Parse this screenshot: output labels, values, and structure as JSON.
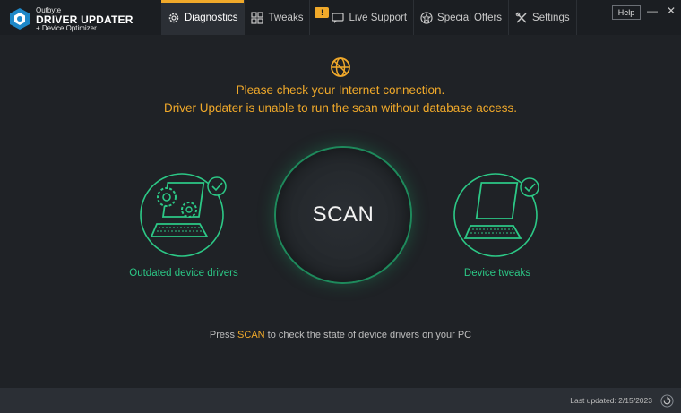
{
  "app": {
    "brand_small": "Outbyte",
    "brand_big": "DRIVER UPDATER",
    "brand_sub": "+ Device Optimizer"
  },
  "tabs": [
    {
      "label": "Diagnostics",
      "icon": "gear-icon",
      "active": true
    },
    {
      "label": "Tweaks",
      "icon": "grid-icon",
      "active": false
    },
    {
      "label": "Live Support",
      "icon": "chat-icon",
      "active": false,
      "badge": "!"
    },
    {
      "label": "Special Offers",
      "icon": "star-icon",
      "active": false
    },
    {
      "label": "Settings",
      "icon": "tools-icon",
      "active": false
    }
  ],
  "window": {
    "help_label": "Help",
    "minimize_glyph": "—",
    "close_glyph": "✕"
  },
  "message": {
    "line1": "Please check your Internet connection.",
    "line2": "Driver Updater is unable to run the scan without database access."
  },
  "left_feature": {
    "label": "Outdated device drivers",
    "icon": "laptop-gears-icon"
  },
  "right_feature": {
    "label": "Device tweaks",
    "icon": "laptop-icon"
  },
  "scan": {
    "label": "SCAN"
  },
  "hint": {
    "prefix": "Press ",
    "keyword": "SCAN",
    "suffix": " to check the state of device drivers on your PC"
  },
  "status": {
    "last_updated": "Last updated: 2/15/2023"
  },
  "colors": {
    "accent": "#f0a92a",
    "green": "#2cc886",
    "background": "#1f2226"
  }
}
